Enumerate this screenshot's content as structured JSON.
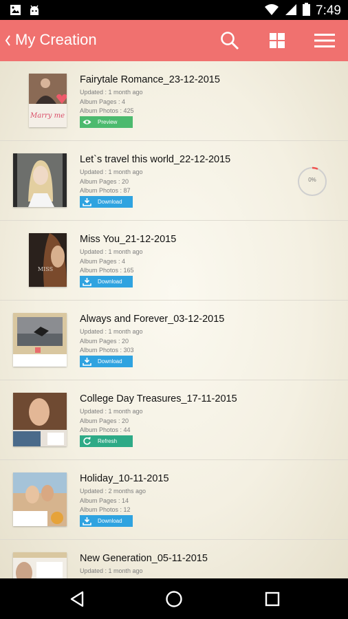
{
  "status_bar": {
    "time": "7:49"
  },
  "app_bar": {
    "title": "My Creation"
  },
  "albums": [
    {
      "title": "Fairytale Romance_23-12-2015",
      "updated": "Updated : 1 month ago",
      "pages": "Album Pages : 4",
      "photos": "Album Photos : 425",
      "action": "Preview",
      "thumb_text": "Marry me"
    },
    {
      "title": "Let`s travel this world_22-12-2015",
      "updated": "Updated : 1 month ago",
      "pages": "Album Pages : 20",
      "photos": "Album Photos : 87",
      "action": "Download",
      "progress": "0%"
    },
    {
      "title": "Miss You_21-12-2015",
      "updated": "Updated : 1 month ago",
      "pages": "Album Pages : 4",
      "photos": "Album Photos : 165",
      "action": "Download",
      "thumb_text": "MISS"
    },
    {
      "title": "Always and Forever_03-12-2015",
      "updated": "Updated : 1 month ago",
      "pages": "Album Pages : 20",
      "photos": "Album Photos : 303",
      "action": "Download"
    },
    {
      "title": "College Day Treasures_17-11-2015",
      "updated": "Updated : 1 month ago",
      "pages": "Album Pages : 20",
      "photos": "Album Photos : 44",
      "action": "Refresh"
    },
    {
      "title": "Holiday_10-11-2015",
      "updated": "Updated : 2 months ago",
      "pages": "Album Pages : 14",
      "photos": "Album Photos : 12",
      "action": "Download"
    },
    {
      "title": "New Generation_05-11-2015",
      "updated": "Updated : 1 month ago"
    }
  ],
  "colors": {
    "app_bar": "#f0716f",
    "preview": "#4cba6e",
    "download": "#2fa3e0",
    "refresh": "#2eaa86"
  },
  "icons": {
    "status_left": [
      "gallery-notification-icon",
      "android-notification-icon"
    ],
    "status_right": [
      "wifi-icon",
      "cell-signal-icon",
      "battery-icon"
    ],
    "app_bar": [
      "back-chevron-icon",
      "search-icon",
      "grid-view-icon",
      "menu-icon"
    ],
    "nav": [
      "back-triangle-icon",
      "home-circle-icon",
      "recents-square-icon"
    ]
  }
}
